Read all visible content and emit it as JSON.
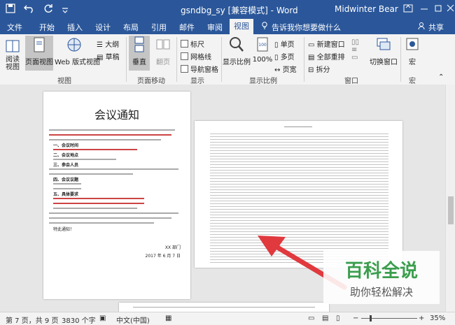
{
  "titlebar": {
    "title": "gsndbg_sy [兼容模式] - Word",
    "user": "Midwinter Bear",
    "bg_color": "#2b579a"
  },
  "tabs": [
    {
      "label": "文件"
    },
    {
      "label": "开始"
    },
    {
      "label": "插入"
    },
    {
      "label": "设计"
    },
    {
      "label": "布局"
    },
    {
      "label": "引用"
    },
    {
      "label": "邮件"
    },
    {
      "label": "审阅"
    },
    {
      "label": "视图",
      "active": true
    }
  ],
  "tellme": "告诉我你想要做什么",
  "share": "共享",
  "ribbon": {
    "read_mode": "阅读\n视图",
    "print_layout": "页面视图",
    "web_layout": "Web 版式视图",
    "outline": "大纲",
    "draft": "草稿",
    "vertical": "垂直",
    "side_by_side": "翻页",
    "ruler": "标尺",
    "gridlines": "网格线",
    "nav_pane": "导航窗格",
    "zoom": "显示比例",
    "zoom100": "100%",
    "one_page": "单页",
    "multi_page": "多页",
    "page_width": "页宽",
    "new_window": "新建窗口",
    "arrange_all": "全部重排",
    "split": "拆分",
    "switch_windows": "切换窗口",
    "macros": "宏",
    "groups": {
      "views": "视图",
      "page_move": "页面移动",
      "show": "显示",
      "zoom": "显示比例",
      "window": "窗口",
      "macros": "宏"
    }
  },
  "document": {
    "title": "会议通知",
    "sign": "XX 部门",
    "date": "2017 年 6 月 7 日",
    "notice_items": [
      "一、会议时间",
      "二、会议地点",
      "三、参会人员",
      "四、会议议题",
      "五、具体要求"
    ],
    "thanks": "特此通知！"
  },
  "watermark": {
    "title": "百科全说",
    "subtitle": "助你轻松解决"
  },
  "status": {
    "page": "第 7 页，共 9 页",
    "words": "3830 个字",
    "language": "中文(中国)",
    "zoom": "35%"
  },
  "colors": {
    "accent": "#2b579a",
    "arrow": "#e0393e",
    "watermark_bg": "#3a9e4d"
  }
}
